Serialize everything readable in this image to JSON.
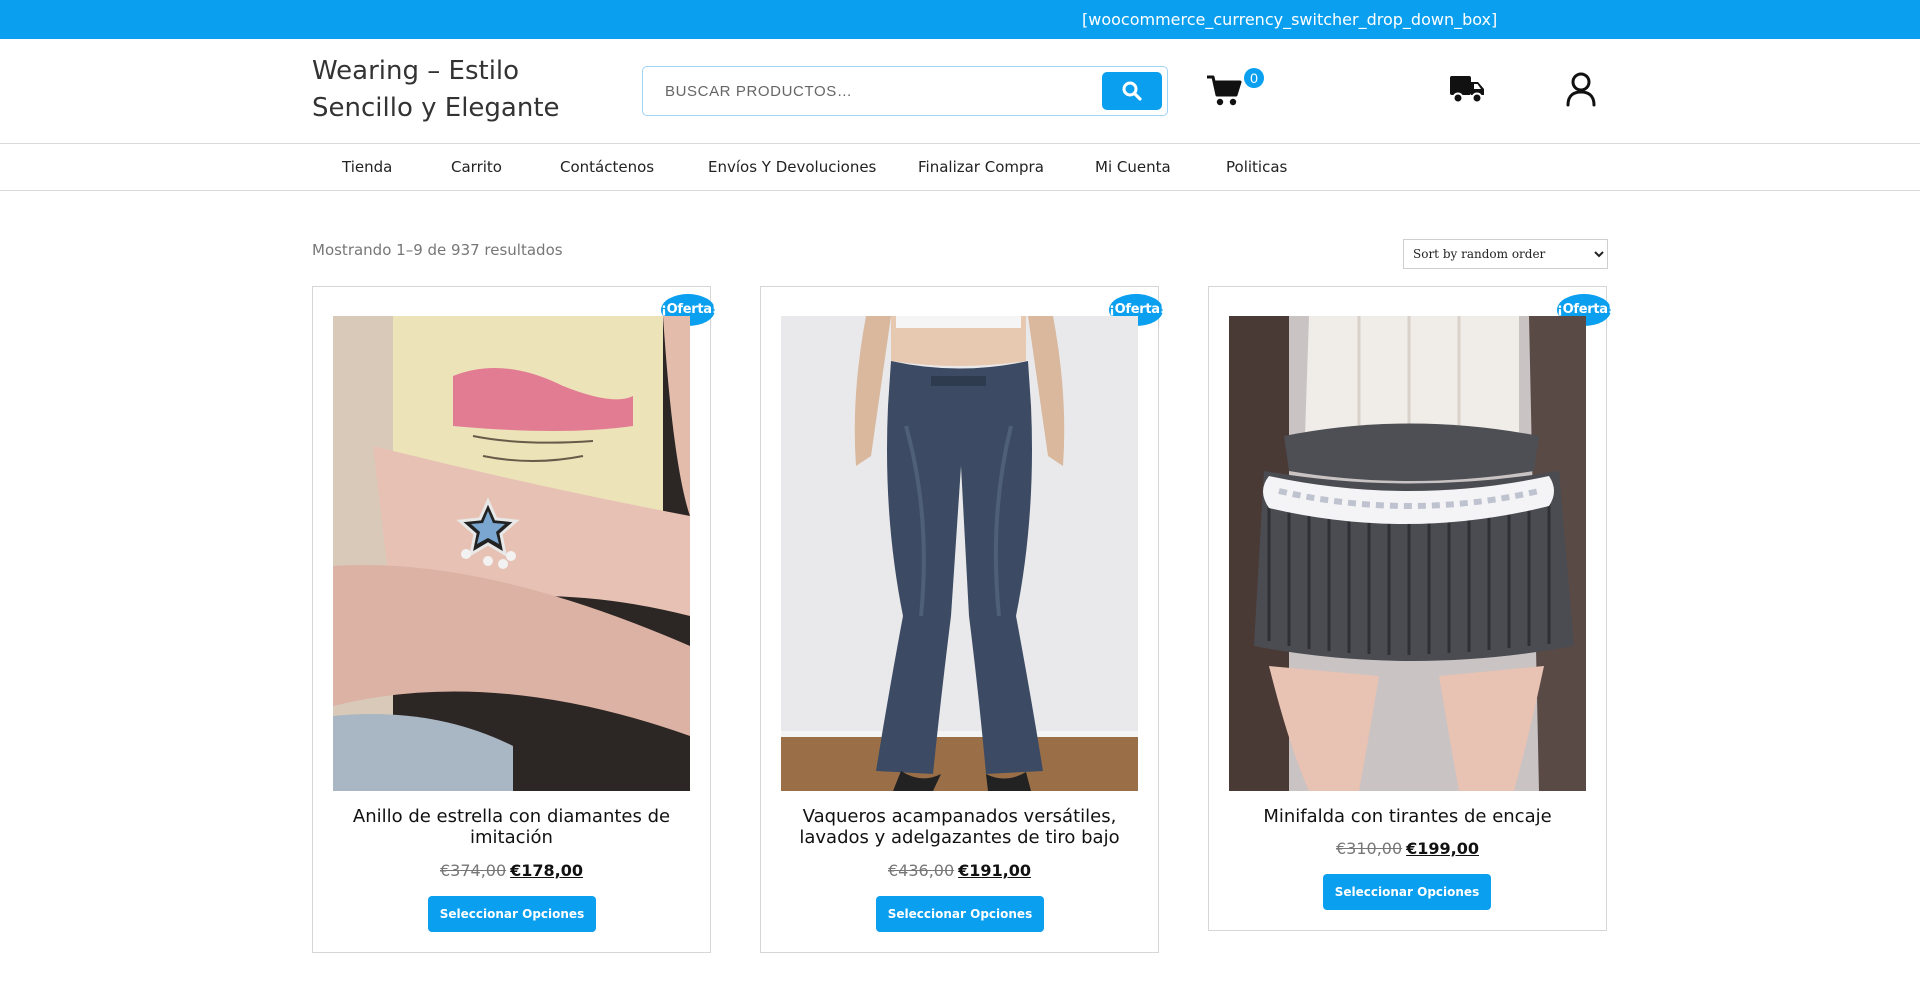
{
  "topbar": {
    "shortcode": "[woocommerce_currency_switcher_drop_down_box]"
  },
  "header": {
    "site_title": "Wearing – Estilo Sencillo y Elegante",
    "search_placeholder": "BUSCAR PRODUCTOS…",
    "cart_count": "0"
  },
  "nav": {
    "items": [
      {
        "label": "Tienda"
      },
      {
        "label": "Carrito"
      },
      {
        "label": "Contáctenos"
      },
      {
        "label": "Envíos Y Devoluciones"
      },
      {
        "label": "Finalizar Compra"
      },
      {
        "label": "Mi Cuenta"
      },
      {
        "label": "Politicas"
      }
    ]
  },
  "shop": {
    "result_count": "Mostrando 1–9 de 937 resultados",
    "orderby_selected": "Sort by random order"
  },
  "products": [
    {
      "badge": "¡Oferta!",
      "title": "Anillo de estrella con diamantes de imitación",
      "old_price": "€374,00",
      "new_price": "€178,00",
      "button": "Seleccionar Opciones"
    },
    {
      "badge": "¡Oferta!",
      "title": "Vaqueros acampanados versátiles, lavados y adelgazantes de tiro bajo",
      "old_price": "€436,00",
      "new_price": "€191,00",
      "button": "Seleccionar Opciones"
    },
    {
      "badge": "¡Oferta!",
      "title": "Minifalda con tirantes de encaje",
      "old_price": "€310,00",
      "new_price": "€199,00",
      "button": "Seleccionar Opciones"
    }
  ],
  "colors": {
    "accent": "#0a9fef"
  },
  "icons": [
    "search-icon",
    "cart-icon",
    "truck-icon",
    "account-icon"
  ]
}
